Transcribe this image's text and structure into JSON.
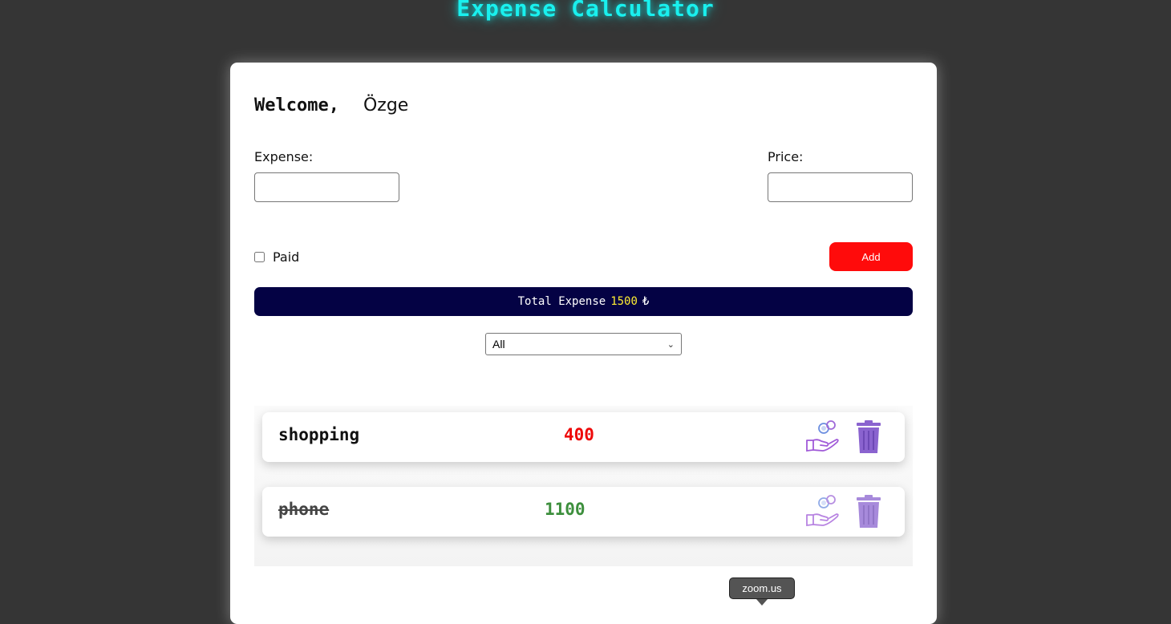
{
  "app_title": "Expense Calculator",
  "welcome": {
    "label": "Welcome,",
    "name": "Özge"
  },
  "form": {
    "expense_label": "Expense:",
    "expense_value": "",
    "price_label": "Price:",
    "price_value": "",
    "paid_label": "Paid",
    "paid_checked": false,
    "add_label": "Add"
  },
  "total": {
    "label": "Total Expense",
    "amount": "1500",
    "currency": "₺"
  },
  "filter": {
    "selected": "All"
  },
  "expenses": [
    {
      "name": "shopping",
      "price": "400",
      "paid": false,
      "price_color": "#ee0a0a"
    },
    {
      "name": "phone",
      "price": "1100",
      "paid": true,
      "price_color": "#3d8f3d"
    }
  ],
  "tooltip": "zoom.us",
  "colors": {
    "title": "#19f0ee",
    "add_button": "#ff0b0b",
    "total_bar": "#040244",
    "total_amount": "#ffee32",
    "icon_purple": "#9a6bd6"
  }
}
